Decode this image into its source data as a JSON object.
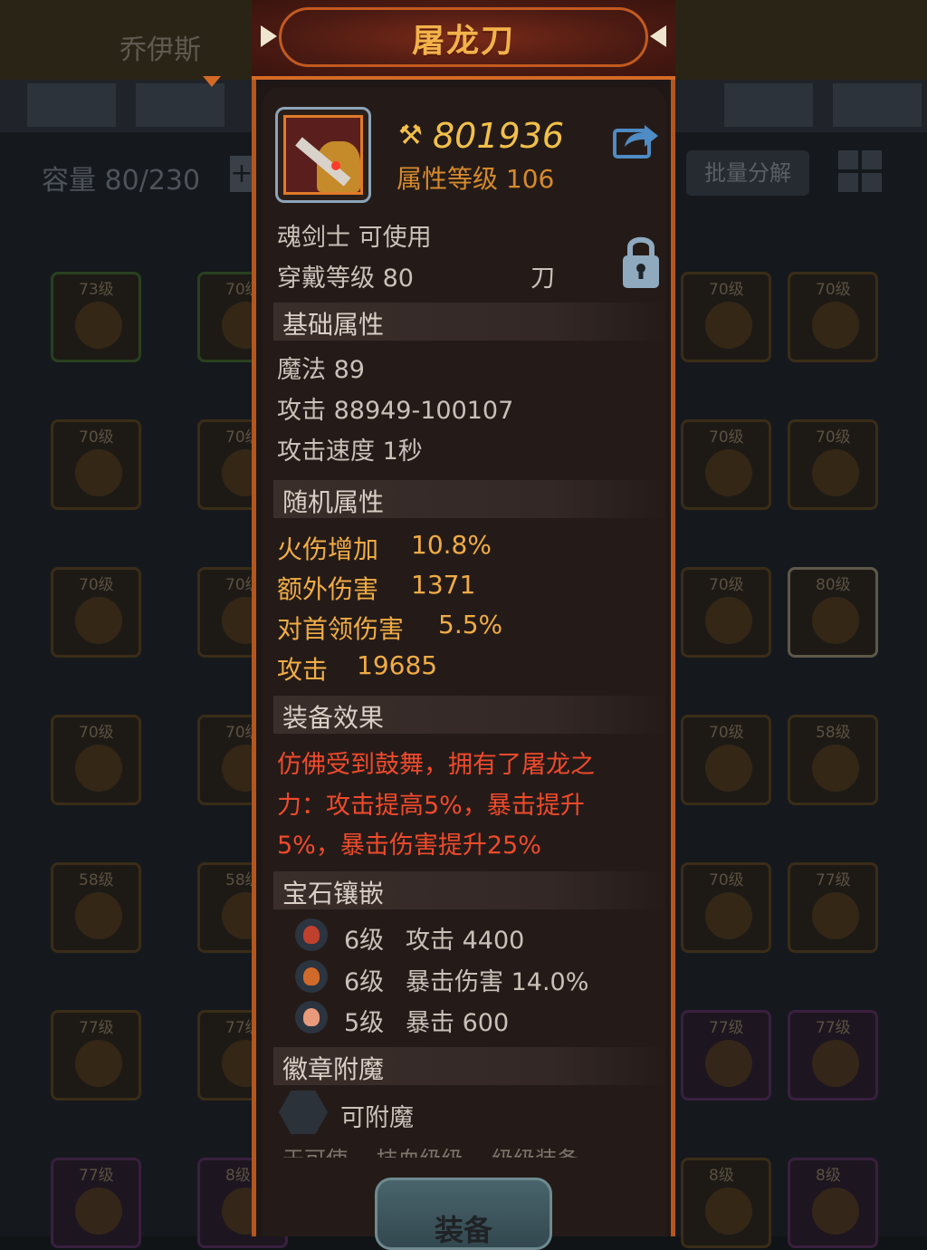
{
  "background": {
    "character_name": "乔伊斯",
    "capacity": "容量 80/230",
    "plus_label": "+",
    "batch_decompose": "批量分解",
    "slots": [
      {
        "level": "73级",
        "tone": "green"
      },
      {
        "level": "70级",
        "tone": "green"
      },
      {
        "level": "70级",
        "tone": "normal"
      },
      {
        "level": "70级",
        "tone": "normal"
      },
      {
        "level": "70级",
        "tone": "normal"
      },
      {
        "level": "70级",
        "tone": "normal"
      },
      {
        "level": "70级",
        "tone": "normal"
      },
      {
        "level": "70级",
        "tone": "normal"
      },
      {
        "level": "70级",
        "tone": "normal"
      },
      {
        "level": "70级",
        "tone": "normal"
      },
      {
        "level": "70级",
        "tone": "normal"
      },
      {
        "level": "80级",
        "tone": "selected"
      },
      {
        "level": "70级",
        "tone": "normal"
      },
      {
        "level": "70级",
        "tone": "normal"
      },
      {
        "level": "70级",
        "tone": "normal"
      },
      {
        "level": "58级",
        "tone": "normal"
      },
      {
        "level": "58级",
        "tone": "normal"
      },
      {
        "level": "58级",
        "tone": "normal"
      },
      {
        "level": "70级",
        "tone": "normal"
      },
      {
        "level": "77级",
        "tone": "normal"
      },
      {
        "level": "77级",
        "tone": "normal"
      },
      {
        "level": "77级",
        "tone": "normal"
      },
      {
        "level": "77级",
        "tone": "purple"
      },
      {
        "level": "77级",
        "tone": "purple"
      },
      {
        "level": "77级",
        "tone": "purple"
      },
      {
        "level": "8级",
        "tone": "purple"
      },
      {
        "level": "8级",
        "tone": "normal"
      },
      {
        "level": "8级",
        "tone": "purple"
      }
    ]
  },
  "item": {
    "name": "屠龙刀",
    "power": "801936",
    "attribute_level": "属性等级 106",
    "usable_by": "魂剑士 可使用",
    "wear_level": "穿戴等级 80",
    "weapon_type": "刀"
  },
  "base_attributes": {
    "header": "基础属性",
    "lines": [
      "魔法  89",
      "攻击  88949-100107",
      "攻击速度  1秒"
    ]
  },
  "random_attributes": {
    "header": "随机属性",
    "lines": [
      {
        "name": "火伤增加",
        "value": "10.8%"
      },
      {
        "name": "额外伤害",
        "value": "1371"
      },
      {
        "name": "对首领伤害",
        "value": "5.5%"
      },
      {
        "name": "攻击",
        "value": "19685"
      }
    ]
  },
  "equip_effect": {
    "header": "装备效果",
    "lines": [
      "仿佛受到鼓舞，拥有了屠龙之",
      "力：攻击提高5%，暴击提升",
      "5%，暴击伤害提升25%"
    ]
  },
  "gems": {
    "header": "宝石镶嵌",
    "items": [
      {
        "level": "6级",
        "effect": "攻击 4400",
        "color": "#c0402e"
      },
      {
        "level": "6级",
        "effect": "暴击伤害 14.0%",
        "color": "#d06a2a"
      },
      {
        "level": "5级",
        "effect": "暴击 600",
        "color": "#e89a7a"
      }
    ]
  },
  "badge_enchant": {
    "header": "徽章附魔",
    "status": "可附魔"
  },
  "truncated_line": "于可使  …技血级级  …级级装备",
  "equip_button": "装备",
  "colors": {
    "panel_border": "#b5561e",
    "title_text": "#f3b24a",
    "power_text": "#f2c04a",
    "random_attr_text": "#f0ac45",
    "effect_text": "#ef4a2c"
  }
}
